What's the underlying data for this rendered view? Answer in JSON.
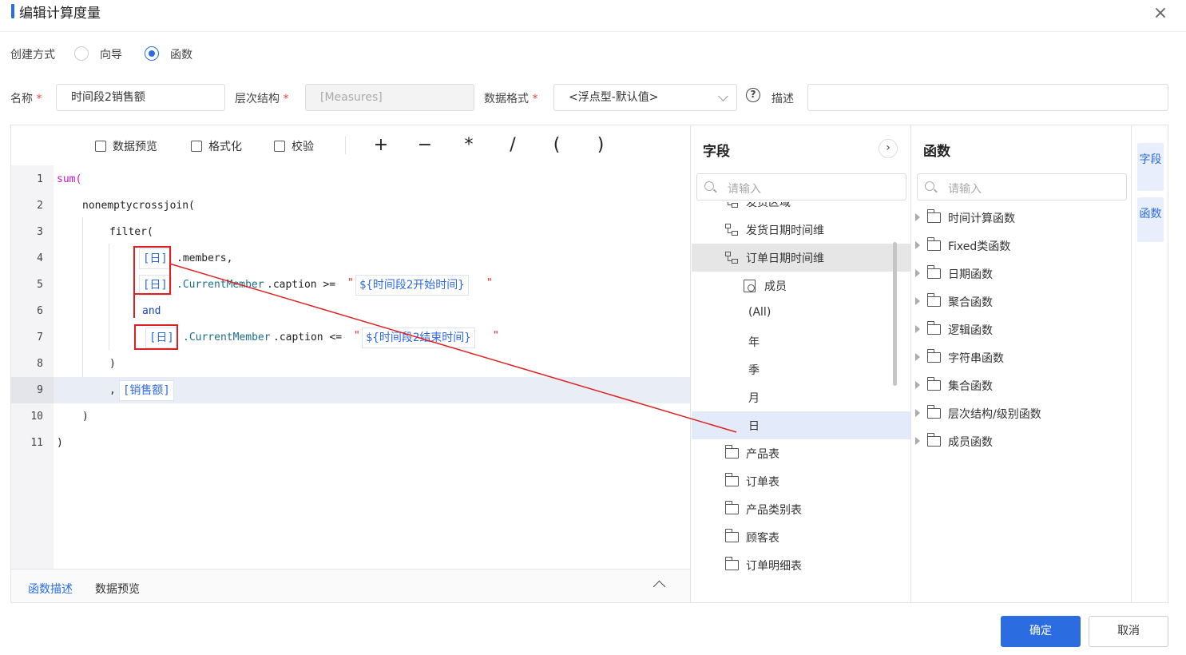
{
  "dialog": {
    "title": "编辑计算度量",
    "close_icon": "×"
  },
  "creation": {
    "label": "创建方式",
    "options": [
      {
        "label": "向导",
        "selected": false
      },
      {
        "label": "函数",
        "selected": true
      }
    ]
  },
  "form": {
    "name_label": "名称",
    "name_value": "时间段2销售额",
    "hierarchy_label": "层次结构",
    "hierarchy_value": "[Measures]",
    "format_label": "数据格式",
    "format_value": "<浮点型-默认值>",
    "help_icon": "?",
    "desc_label": "描述",
    "desc_value": ""
  },
  "toolbar": {
    "preview": "数据预览",
    "format": "格式化",
    "validate": "校验",
    "operators": [
      "+",
      "−",
      "*",
      "/",
      "(",
      ")"
    ]
  },
  "code": {
    "line_numbers": [
      "1",
      "2",
      "3",
      "4",
      "5",
      "6",
      "7",
      "8",
      "9",
      "10",
      "11"
    ],
    "l1": "sum(",
    "l2": "nonemptycrossjoin(",
    "l3": "filter(",
    "tok_day": "[日]",
    "members": ".members,",
    "cm": ".CurrentMember",
    "caption_ge": ".caption >=",
    "caption_le": ".caption <=",
    "quote": "\"",
    "tok_start": "${时间段2开始时间}",
    "tok_end": "${时间段2结束时间}",
    "and": "and",
    "close_paren": ")",
    "comma": ",",
    "tok_sales": "[销售额]"
  },
  "bottom_tabs": {
    "desc": "函数描述",
    "preview": "数据预览"
  },
  "fields_panel": {
    "title": "字段",
    "expand": "›",
    "search_placeholder": "请输入",
    "items": [
      "发货区域",
      "发货日期时间维",
      "订单日期时间维",
      "成员",
      "(All)",
      "年",
      "季",
      "月",
      "日",
      "产品表",
      "订单表",
      "产品类别表",
      "顾客表",
      "订单明细表"
    ]
  },
  "functions_panel": {
    "title": "函数",
    "search_placeholder": "请输入",
    "items": [
      "时间计算函数",
      "Fixed类函数",
      "日期函数",
      "聚合函数",
      "逻辑函数",
      "字符串函数",
      "集合函数",
      "层次结构/级别函数",
      "成员函数"
    ]
  },
  "side_tabs": {
    "fields": "字段",
    "functions": "函数"
  },
  "footer": {
    "confirm": "确定",
    "cancel": "取消"
  },
  "colors": {
    "accent": "#2b6de0",
    "annotation": "#e02020"
  }
}
